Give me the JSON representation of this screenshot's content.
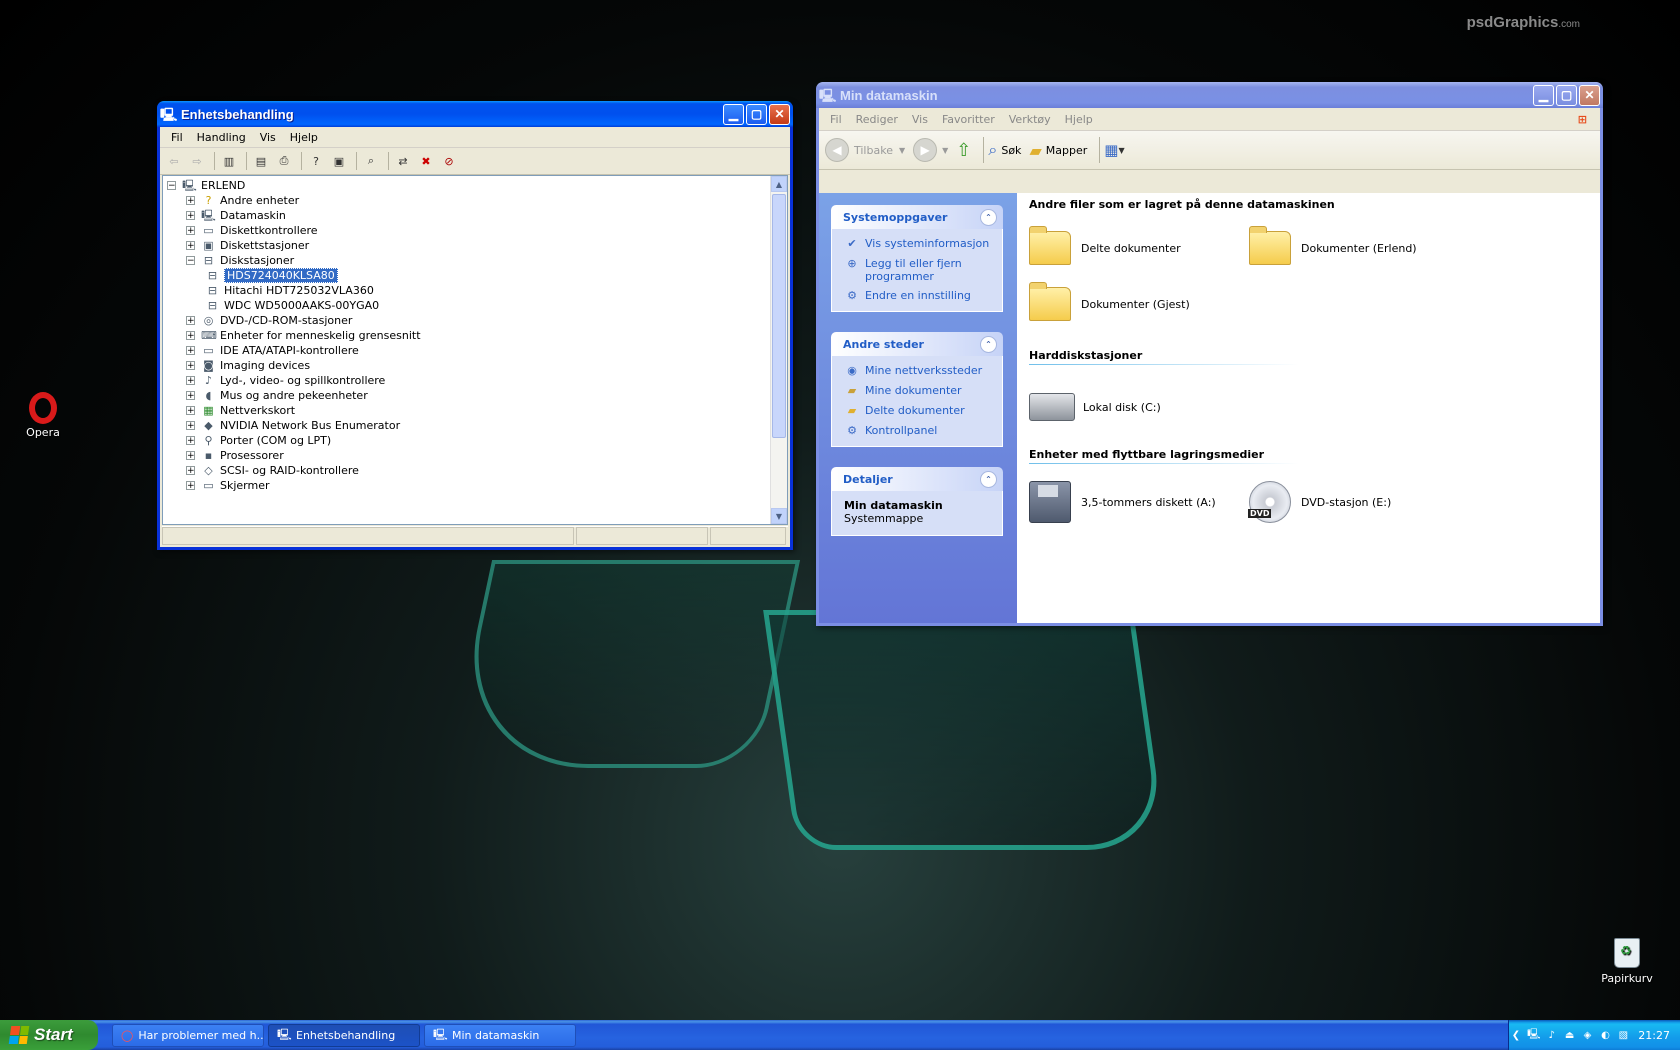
{
  "desktop": {
    "watermark": "psdGraphics",
    "watermark_suffix": ".com",
    "icons": [
      {
        "label": "Opera",
        "icon": "opera-icon"
      },
      {
        "label": "Papirkurv",
        "icon": "recycle-bin-icon"
      }
    ]
  },
  "device_manager": {
    "title": "Enhetsbehandling",
    "menu": [
      "Fil",
      "Handling",
      "Vis",
      "Hjelp"
    ],
    "tree": {
      "root": "ERLEND",
      "nodes": [
        {
          "label": "Andre enheter",
          "icon": "unknown-device-icon"
        },
        {
          "label": "Datamaskin",
          "icon": "computer-icon"
        },
        {
          "label": "Diskettkontrollere",
          "icon": "controller-icon"
        },
        {
          "label": "Diskettstasjoner",
          "icon": "floppy-icon"
        },
        {
          "label": "Diskstasjoner",
          "icon": "disk-icon",
          "expanded": true,
          "children": [
            "HDS724040KLSA80",
            "Hitachi HDT725032VLA360",
            "WDC WD5000AAKS-00YGA0"
          ]
        },
        {
          "label": "DVD-/CD-ROM-stasjoner",
          "icon": "cdrom-icon"
        },
        {
          "label": "Enheter for menneskelig grensesnitt",
          "icon": "hid-icon"
        },
        {
          "label": "IDE ATA/ATAPI-kontrollere",
          "icon": "ide-icon"
        },
        {
          "label": "Imaging devices",
          "icon": "camera-icon"
        },
        {
          "label": "Lyd-, video- og spillkontrollere",
          "icon": "sound-icon"
        },
        {
          "label": "Mus og andre pekeenheter",
          "icon": "mouse-icon"
        },
        {
          "label": "Nettverkskort",
          "icon": "network-card-icon"
        },
        {
          "label": "NVIDIA Network Bus Enumerator",
          "icon": "bus-icon"
        },
        {
          "label": "Porter (COM og LPT)",
          "icon": "port-icon"
        },
        {
          "label": "Prosessorer",
          "icon": "cpu-icon"
        },
        {
          "label": "SCSI- og RAID-kontrollere",
          "icon": "scsi-icon"
        },
        {
          "label": "Skjermer",
          "icon": "monitor-icon"
        }
      ],
      "selected_child": "HDS724040KLSA80"
    }
  },
  "explorer": {
    "title": "Min datamaskin",
    "menu": [
      "Fil",
      "Rediger",
      "Vis",
      "Favoritter",
      "Verktøy",
      "Hjelp"
    ],
    "toolbar": {
      "back": "Tilbake",
      "search": "Søk",
      "folders": "Mapper"
    },
    "panels": {
      "system_tasks": {
        "title": "Systemoppgaver",
        "items": [
          "Vis systeminformasjon",
          "Legg til eller fjern programmer",
          "Endre en innstilling"
        ]
      },
      "other_places": {
        "title": "Andre steder",
        "items": [
          "Mine nettverkssteder",
          "Mine dokumenter",
          "Delte dokumenter",
          "Kontrollpanel"
        ]
      },
      "details": {
        "title": "Detaljer",
        "name": "Min datamaskin",
        "type": "Systemmappe"
      }
    },
    "groups": {
      "files_title": "Andre filer som er lagret på denne datamaskinen",
      "files": [
        "Delte dokumenter",
        "Dokumenter (Erlend)",
        "Dokumenter (Gjest)"
      ],
      "hdd_title": "Harddiskstasjoner",
      "hdds": [
        "Lokal disk (C:)"
      ],
      "removable_title": "Enheter med flyttbare lagringsmedier",
      "removables": [
        "3,5-tommers diskett (A:)",
        "DVD-stasjon (E:)"
      ]
    }
  },
  "taskbar": {
    "start": "Start",
    "tasks": [
      {
        "label": "Har problemer med h...",
        "icon": "opera-icon"
      },
      {
        "label": "Enhetsbehandling",
        "icon": "device-manager-icon",
        "active": true
      },
      {
        "label": "Min datamaskin",
        "icon": "my-computer-icon"
      }
    ],
    "clock": "21:27"
  },
  "colors": {
    "xp_blue": "#0831d9",
    "selection": "#316ac5",
    "link": "#215dc6",
    "start_green": "#3c9c3c"
  }
}
